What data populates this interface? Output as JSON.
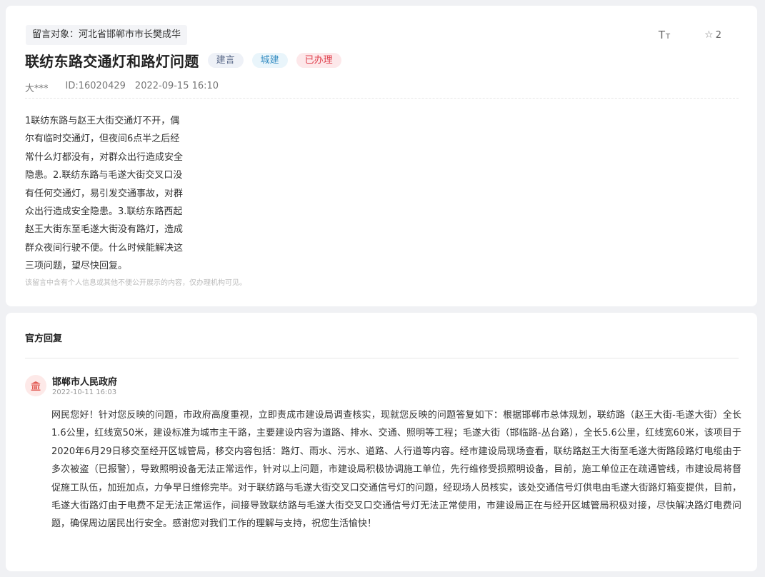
{
  "post": {
    "target": "留言对象：河北省邯郸市市长樊成华",
    "font_tool_big": "T",
    "font_tool_small": "T",
    "star_count": "2",
    "title": "联纺东路交通灯和路灯问题",
    "tags": {
      "type": "建言",
      "field": "城建",
      "status": "已办理"
    },
    "author": "大***",
    "message_id": "ID:16020429",
    "datetime": "2022-09-15 16:10",
    "content": "1联纺东路与赵王大街交通灯不开，偶尔有临时交通灯，但夜间6点半之后经常什么灯都没有，对群众出行造成安全隐患。2.联纺东路与毛遂大街交叉口没有任何交通灯，易引发交通事故，对群众出行造成安全隐患。3.联纺东路西起赵王大街东至毛遂大街没有路灯，造成群众夜间行驶不便。什么时候能解决这三项问题，望尽快回复。",
    "privacy_notice": "该留言中含有个人信息或其他不便公开展示的内容，仅办理机构可见。"
  },
  "reply": {
    "section_title": "官方回复",
    "org_name": "邯郸市人民政府",
    "date": "2022-10-11 16:03",
    "text": "网民您好！针对您反映的问题，市政府高度重视，立即责成市建设局调查核实，现就您反映的问题答复如下：根据邯郸市总体规划，联纺路（赵王大街-毛遂大街）全长1.6公里，红线宽50米，建设标准为城市主干路，主要建设内容为道路、排水、交通、照明等工程；毛遂大街（邯临路-丛台路），全长5.6公里，红线宽60米，该项目于2020年6月29日移交至经开区城管局，移交内容包括：路灯、雨水、污水、道路、人行道等内容。经市建设局现场查看，联纺路赵王大街至毛遂大街路段路灯电缆由于多次被盗（已报警），导致照明设备无法正常运作，针对以上问题，市建设局积极协调施工单位，先行维修受损照明设备，目前，施工单位正在疏通管线，市建设局将督促施工队伍，加班加点，力争早日维修完毕。对于联纺路与毛遂大街交叉口交通信号灯的问题，经现场人员核实，该处交通信号灯供电由毛遂大街路灯箱变提供，目前，毛遂大街路灯由于电费不足无法正常运作，间接导致联纺路与毛遂大街交叉口交通信号灯无法正常使用，市建设局正在与经开区城管局积极对接，尽快解决路灯电费问题，确保周边居民出行安全。感谢您对我们工作的理解与支持，祝您生活愉快！"
  },
  "icons": {
    "font_size": "font-size-icon",
    "star": "star-icon",
    "government": "government-building-icon"
  },
  "colors": {
    "status_red": "#e0424f",
    "field_blue": "#3a8fc3",
    "type_slate": "#5c6b8a",
    "avatar_red": "#e25b54"
  }
}
